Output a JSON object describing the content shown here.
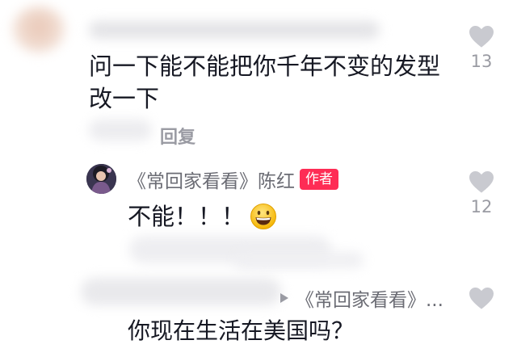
{
  "comment1": {
    "text_line1": "问一下能不能把你千年不变的发型",
    "text_line2": "改一下",
    "like_count": "13",
    "reply_label": "回复"
  },
  "reply1": {
    "author": "《常回家看看》陈红",
    "badge": "作者",
    "text": "不能！！！",
    "emoji_icon": "grinning-face-emoji",
    "like_count": "12"
  },
  "comment3": {
    "reply_to": "《常回家看看》...",
    "text": "你现在生活在美国吗？"
  },
  "colors": {
    "badge": "#fe2c55",
    "muted_text": "#9a9ba3",
    "heart": "#c9cad0"
  }
}
